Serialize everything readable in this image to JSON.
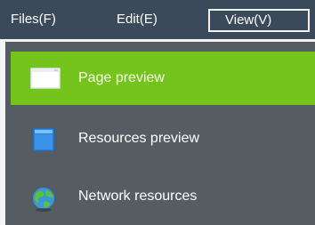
{
  "menubar": {
    "files_label": "Files(F)",
    "edit_label": "Edit(E)",
    "view_label": "View(V)"
  },
  "view_menu": {
    "items": [
      {
        "label": "Page preview",
        "icon": "page-preview-icon",
        "selected": true
      },
      {
        "label": "Resources preview",
        "icon": "resources-preview-icon",
        "selected": false
      },
      {
        "label": "Network resources",
        "icon": "globe-icon",
        "selected": false
      }
    ]
  },
  "colors": {
    "menubar_bg": "#3b4a5a",
    "dropdown_bg": "#555d62",
    "highlight": "#75c41d",
    "text": "#ffffff"
  }
}
